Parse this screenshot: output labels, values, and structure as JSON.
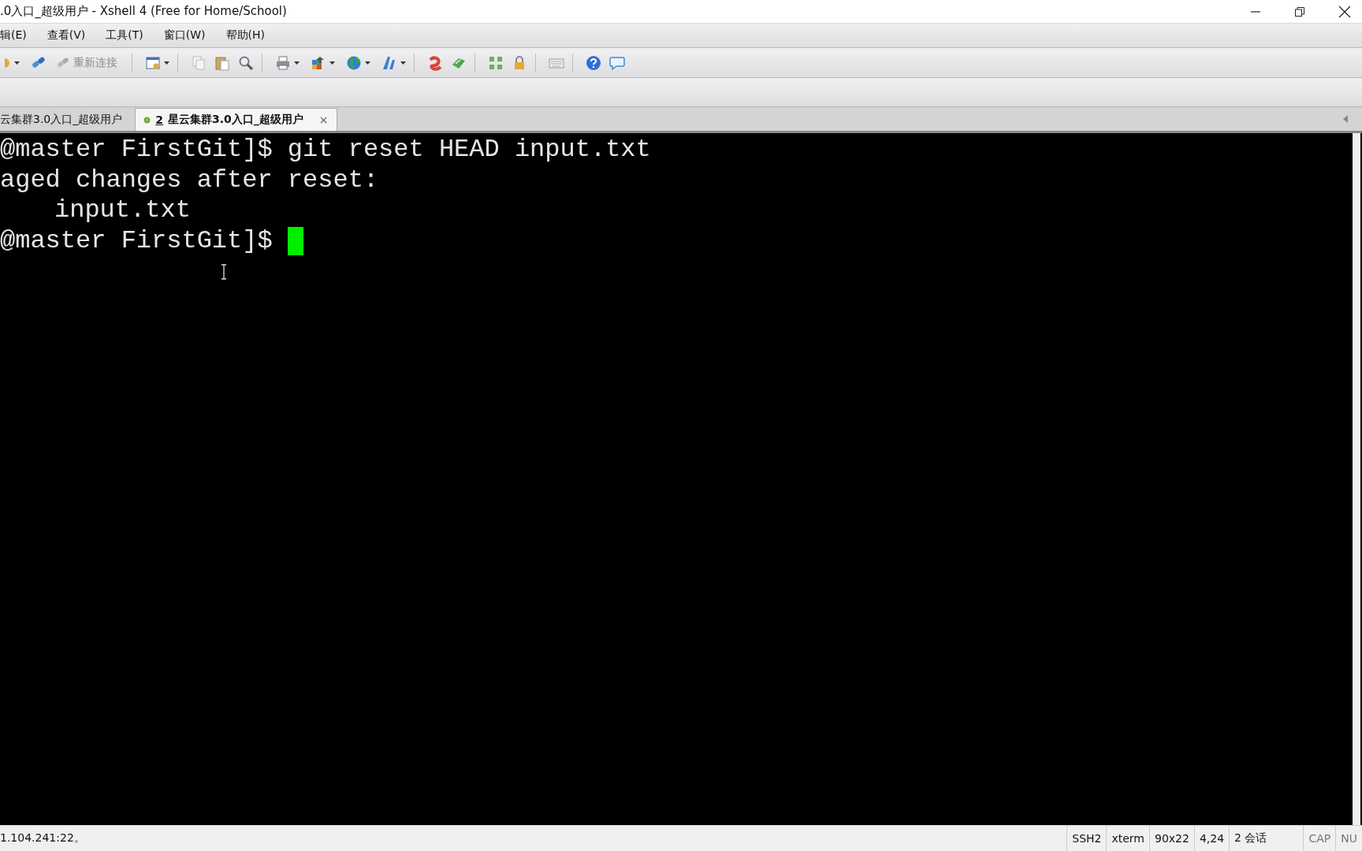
{
  "window": {
    "title": ".0入口_超级用户 - Xshell 4 (Free for Home/School)"
  },
  "menu": [
    "辑(E)",
    "查看(V)",
    "工具(T)",
    "窗口(W)",
    "帮助(H)"
  ],
  "toolbar": {
    "reconnect": {
      "label": "重新连接",
      "disabled": true
    }
  },
  "tabs": [
    {
      "label": "云集群3.0入口_超级用户",
      "selected": false
    },
    {
      "number": "2",
      "label": "星云集群3.0入口_超级用户",
      "selected": true,
      "close": "×"
    }
  ],
  "terminal": {
    "lines": [
      {
        "text": "@master FirstGit]$ git reset HEAD input.txt",
        "indent": false,
        "cursor": false
      },
      {
        "text": "aged changes after reset:",
        "indent": false,
        "cursor": false
      },
      {
        "text": "input.txt",
        "indent": true,
        "cursor": false
      },
      {
        "text": "@master FirstGit]$ ",
        "indent": false,
        "cursor": true
      }
    ]
  },
  "status_bar": {
    "message": "1.104.241:22。",
    "cells": [
      "SSH2",
      "xterm",
      "90x22",
      "4,24",
      "2 会话",
      "CAP",
      "NU"
    ]
  }
}
